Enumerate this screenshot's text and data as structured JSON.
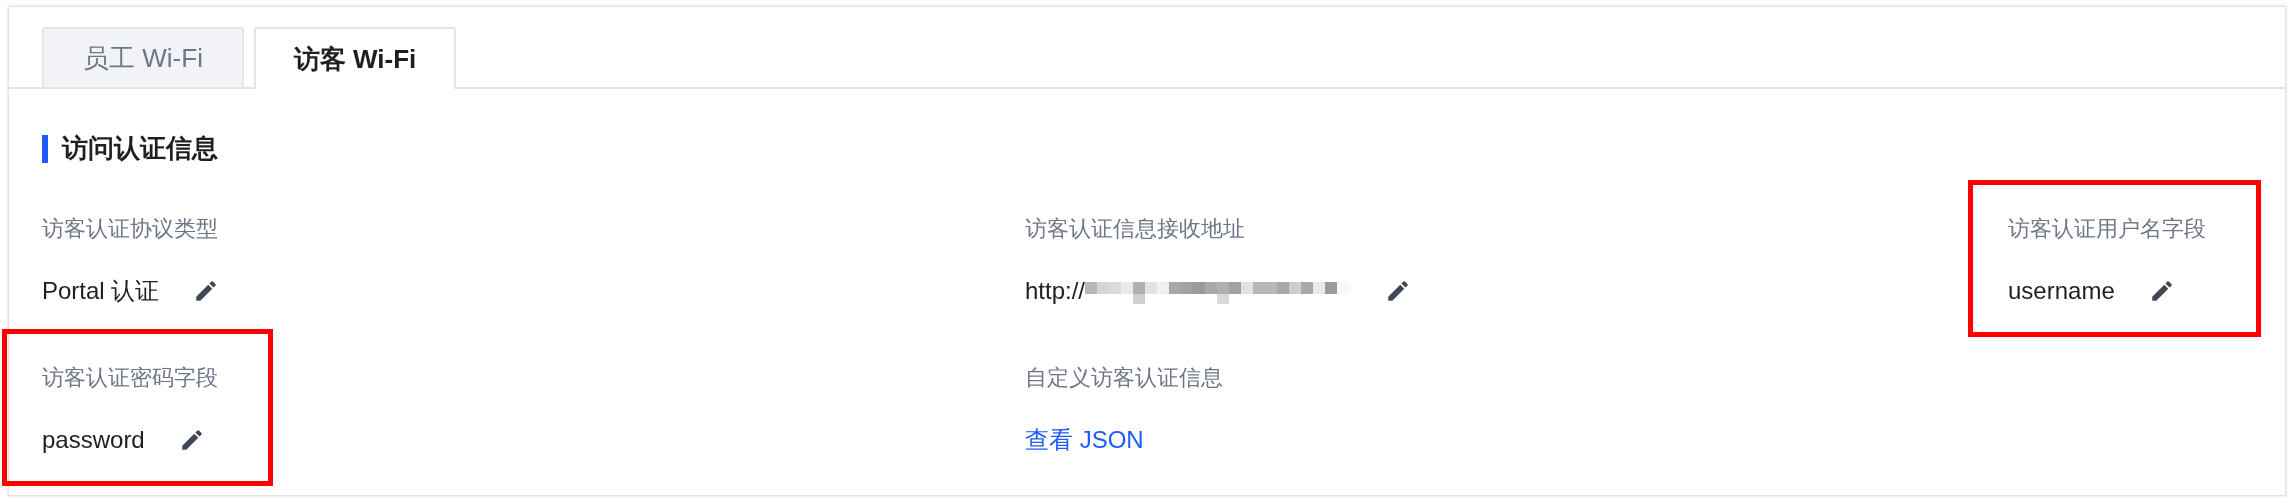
{
  "tabs": [
    {
      "label": "员工 Wi-Fi",
      "selected": false
    },
    {
      "label": "访客 Wi-Fi",
      "selected": true
    }
  ],
  "section": {
    "title": "访问认证信息"
  },
  "fields": [
    {
      "label": "访客认证协议类型",
      "value": "Portal 认证",
      "kind": "editable",
      "highlighted": false
    },
    {
      "label": "访客认证信息接收地址",
      "value": "http://",
      "kind": "redacted",
      "highlighted": false
    },
    {
      "label": "访客认证用户名字段",
      "value": "username",
      "kind": "editable",
      "highlighted": true
    },
    {
      "label": "访客认证密码字段",
      "value": "password",
      "kind": "editable",
      "highlighted": true
    },
    {
      "label": "自定义访客认证信息",
      "value": "查看 JSON",
      "kind": "link",
      "highlighted": false
    }
  ]
}
